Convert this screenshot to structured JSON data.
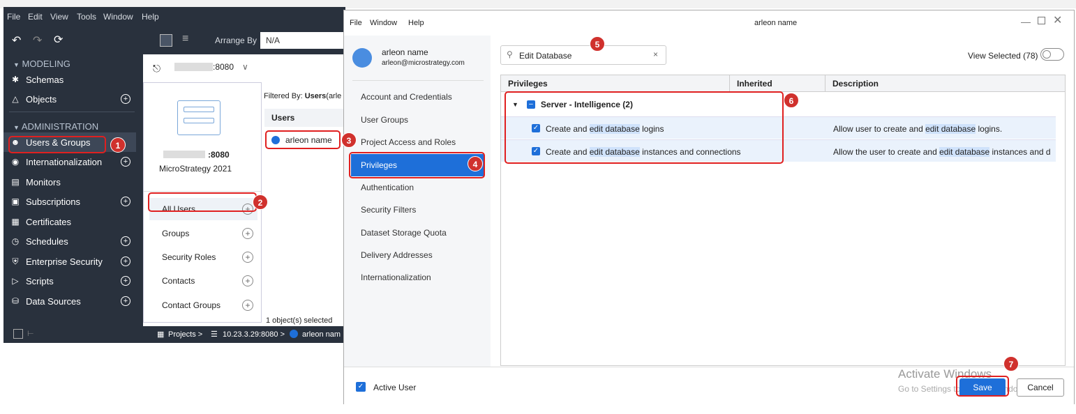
{
  "app": {
    "menu": [
      "File",
      "Edit",
      "View",
      "Tools",
      "Window",
      "Help"
    ],
    "arrange_label": "Arrange By",
    "arrange_value": "N/A",
    "server_label": ":8080",
    "sidebar": {
      "modeling_header": "MODELING",
      "admin_header": "ADMINISTRATION",
      "items": [
        {
          "label": "Schemas",
          "icon": "schema-icon",
          "plus": false
        },
        {
          "label": "Objects",
          "icon": "objects-icon",
          "plus": true
        },
        {
          "label": "Users & Groups",
          "icon": "users-icon",
          "plus": false
        },
        {
          "label": "Internationalization",
          "icon": "globe-icon",
          "plus": true
        },
        {
          "label": "Monitors",
          "icon": "monitor-icon",
          "plus": false
        },
        {
          "label": "Subscriptions",
          "icon": "subscription-icon",
          "plus": true
        },
        {
          "label": "Certificates",
          "icon": "certificate-icon",
          "plus": false
        },
        {
          "label": "Schedules",
          "icon": "clock-icon",
          "plus": true
        },
        {
          "label": "Enterprise Security",
          "icon": "shield-icon",
          "plus": true
        },
        {
          "label": "Scripts",
          "icon": "script-icon",
          "plus": true
        },
        {
          "label": "Data Sources",
          "icon": "database-icon",
          "plus": true
        }
      ]
    },
    "server_card": {
      "name": ":8080",
      "product": "MicroStrategy 2021"
    },
    "groups": [
      "All Users",
      "Groups",
      "Security Roles",
      "Contacts",
      "Contact Groups"
    ],
    "filtered_by": "Filtered By:",
    "filtered_value": "Users",
    "filtered_suffix": "(arle",
    "users_header": "Users",
    "user_row": "arleon name",
    "selected_count": "1 object(s) selected",
    "breadcrumb": {
      "projects": "Projects >",
      "server": "10.23.3.29:8080 >",
      "user": "arleon nam"
    }
  },
  "dialog": {
    "menu": [
      "File",
      "Window",
      "Help"
    ],
    "title": "arleon name",
    "user_name": "arleon name",
    "user_email": "arleon@microstrategy.com",
    "nav": [
      "Account and Credentials",
      "User Groups",
      "Project Access and Roles",
      "Privileges",
      "Authentication",
      "Security Filters",
      "Dataset Storage Quota",
      "Delivery Addresses",
      "Internationalization"
    ],
    "active_nav": "Privileges",
    "search_value": "Edit Database",
    "view_selected": "View Selected (78)",
    "columns": {
      "privileges": "Privileges",
      "inherited": "Inherited",
      "description": "Description"
    },
    "group_label": "Server - Intelligence (2)",
    "rows": [
      {
        "pre": "Create and ",
        "hl": "edit database",
        "post": " logins",
        "dpre": "Allow user to create and ",
        "dhl": "edit database",
        "dpost": " logins."
      },
      {
        "pre": "Create and ",
        "hl": "edit database",
        "post": " instances and connections",
        "dpre": "Allow the user to create and ",
        "dhl": "edit database",
        "dpost": " instances and d"
      }
    ],
    "active_user": "Active User",
    "save": "Save",
    "cancel": "Cancel",
    "watermark_1": "Activate Windows",
    "watermark_2": "Go to Settings to activate Windows."
  },
  "badges": [
    "1",
    "2",
    "3",
    "4",
    "5",
    "6",
    "7"
  ],
  "colors": {
    "accent": "#1e6fd9",
    "annotation": "#d0312d",
    "sidebar_bg": "#29313d"
  }
}
